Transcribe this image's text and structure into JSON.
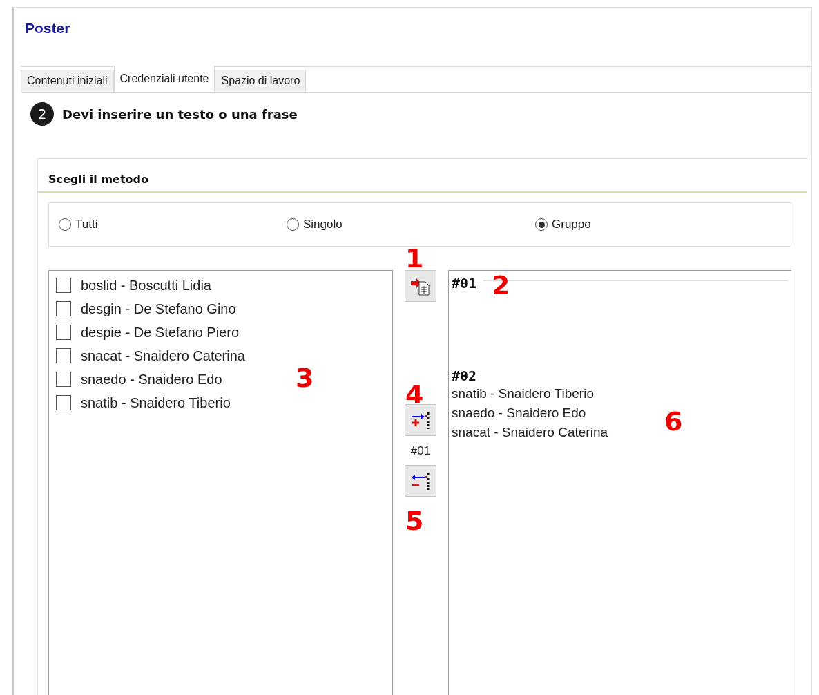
{
  "window": {
    "title": "Poster"
  },
  "tabs": [
    {
      "label": "Contenuti iniziali",
      "selected": false
    },
    {
      "label": "Credenziali utente",
      "selected": true
    },
    {
      "label": "Spazio di lavoro",
      "selected": false
    }
  ],
  "step": {
    "number": "2",
    "title": "Devi inserire un testo o una frase"
  },
  "method_group": {
    "title": "Scegli il metodo",
    "options": [
      {
        "label": "Tutti",
        "selected": false
      },
      {
        "label": "Singolo",
        "selected": false
      },
      {
        "label": "Gruppo",
        "selected": true
      }
    ]
  },
  "users": [
    {
      "label": "boslid - Boscutti Lidia",
      "checked": false
    },
    {
      "label": "desgin - De Stefano Gino",
      "checked": false
    },
    {
      "label": "despie - De Stefano Piero",
      "checked": false
    },
    {
      "label": "snacat - Snaidero Caterina",
      "checked": false
    },
    {
      "label": "snaedo - Snaidero Edo",
      "checked": false
    },
    {
      "label": "snatib - Snaidero Tiberio",
      "checked": false
    }
  ],
  "actions": {
    "current_group": "#01"
  },
  "groups": [
    {
      "name": "#01"
    },
    {
      "name": "#02",
      "members": [
        "snatib - Snaidero Tiberio",
        "snaedo - Snaidero Edo",
        "snacat - Snaidero Caterina"
      ]
    }
  ],
  "annotations": [
    "1",
    "2",
    "3",
    "4",
    "5",
    "6"
  ]
}
